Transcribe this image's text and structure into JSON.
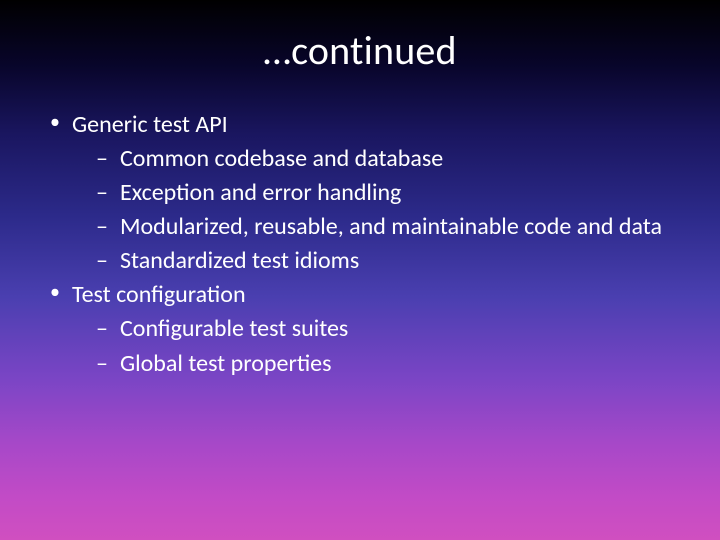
{
  "title": "…continued",
  "bullets": [
    {
      "label": "Generic test API",
      "children": [
        "Common codebase and database",
        "Exception and error handling",
        "Modularized, reusable, and maintainable code and data",
        "Standardized test idioms"
      ]
    },
    {
      "label": "Test configuration",
      "children": [
        "Configurable test suites",
        "Global test properties"
      ]
    }
  ]
}
